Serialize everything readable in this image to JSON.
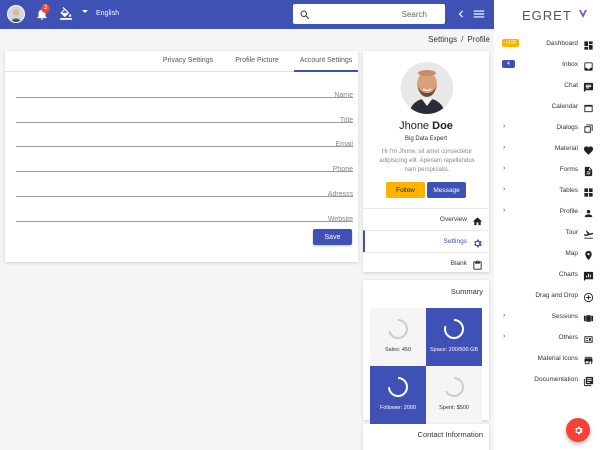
{
  "topbar": {
    "notification_count": "3",
    "language": "English",
    "search_placeholder": "Search",
    "accent_color": "#3f51b5"
  },
  "breadcrumb": {
    "parent": "Settings",
    "separator": "/",
    "current": "Profile"
  },
  "tabs": [
    {
      "label": "Privacy Settings"
    },
    {
      "label": "Profile Picture"
    },
    {
      "label": "Account Settings",
      "active": true
    }
  ],
  "form": {
    "fields": [
      {
        "placeholder": "Name",
        "value": ""
      },
      {
        "placeholder": "Title",
        "value": ""
      },
      {
        "placeholder": "Email",
        "value": ""
      },
      {
        "placeholder": "Phone",
        "value": ""
      },
      {
        "placeholder": "Adresss",
        "value": ""
      },
      {
        "placeholder": "Website",
        "value": ""
      }
    ],
    "save_label": "Save"
  },
  "profile": {
    "first_name": "Jhone",
    "last_name": "Doe",
    "title": "Big Data Expert",
    "bio": "Hi I'm Jhone, sit amet consectetur adipisicing elit. Aperiam repellendus nam perspiciatis.",
    "follow_label": "Follow",
    "message_label": "Message",
    "nav": [
      {
        "label": "Overview",
        "icon": "home-icon"
      },
      {
        "label": "Settings",
        "icon": "gear-icon",
        "active": true
      },
      {
        "label": "Blank",
        "icon": "clipboard-icon"
      }
    ]
  },
  "summary": {
    "title": "Summary",
    "tiles": [
      {
        "label": "Sales: 450",
        "style": "light"
      },
      {
        "label": "Space: 200/500 GB",
        "style": "blue"
      },
      {
        "label": "Follower: 2000",
        "style": "blue"
      },
      {
        "label": "Spent: $500",
        "style": "light"
      }
    ]
  },
  "contact": {
    "title": "Contact Information"
  },
  "sidebar": {
    "brand": "EGRET",
    "items": [
      {
        "label": "Dashboard",
        "icon": "dashboard-icon",
        "badge": "+100",
        "badge_color": "#ffb300"
      },
      {
        "label": "Inbox",
        "icon": "inbox-icon",
        "badge": "4",
        "badge_color": "#3f51b5"
      },
      {
        "label": "Chat",
        "icon": "chat-icon"
      },
      {
        "label": "Calendar",
        "icon": "calendar-icon"
      },
      {
        "label": "Dialogs",
        "icon": "dialogs-icon",
        "expandable": true
      },
      {
        "label": "Material",
        "icon": "heart-icon",
        "expandable": true
      },
      {
        "label": "Forms",
        "icon": "forms-icon",
        "expandable": true
      },
      {
        "label": "Tables",
        "icon": "tables-icon",
        "expandable": true
      },
      {
        "label": "Profile",
        "icon": "person-icon",
        "expandable": true
      },
      {
        "label": "Tour",
        "icon": "flight-icon"
      },
      {
        "label": "Map",
        "icon": "map-pin-icon"
      },
      {
        "label": "Charts",
        "icon": "chart-icon"
      },
      {
        "label": "Drag and Drop",
        "icon": "drag-icon"
      },
      {
        "label": "Sessions",
        "icon": "sessions-icon",
        "expandable": true
      },
      {
        "label": "Others",
        "icon": "others-icon",
        "expandable": true
      },
      {
        "label": "Material Icons",
        "icon": "store-icon"
      },
      {
        "label": "Documentation",
        "icon": "library-icon"
      }
    ]
  }
}
